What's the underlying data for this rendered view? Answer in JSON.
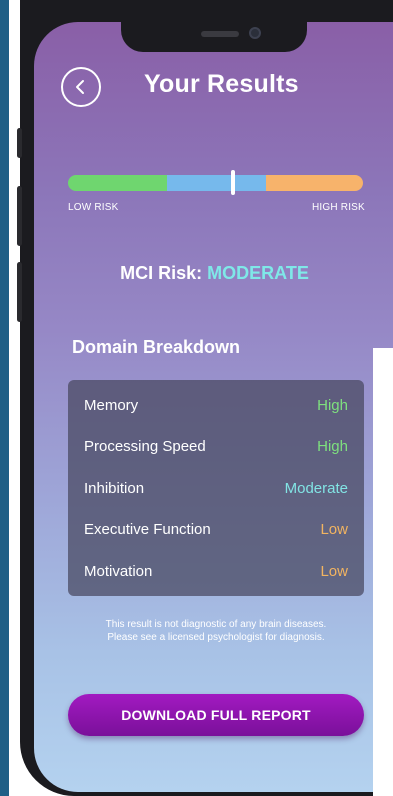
{
  "header": {
    "title": "Your Results",
    "back_icon": "chevron-left-icon"
  },
  "risk_scale": {
    "low_label": "LOW RISK",
    "high_label": "HIGH RISK",
    "colors": {
      "low": "#6fd66f",
      "moderate": "#76b9ec",
      "high": "#f7b36b"
    },
    "marker_position": 0.56
  },
  "mci": {
    "prefix": "MCI Risk:",
    "value": "MODERATE"
  },
  "domain_breakdown": {
    "title": "Domain Breakdown",
    "rows": [
      {
        "name": "Memory",
        "level": "High"
      },
      {
        "name": "Processing Speed",
        "level": "High"
      },
      {
        "name": "Inhibition",
        "level": "Moderate"
      },
      {
        "name": "Executive Function",
        "level": "Low"
      },
      {
        "name": "Motivation",
        "level": "Low"
      }
    ],
    "level_colors": {
      "High": "#7ee07e",
      "Moderate": "#82e4e4",
      "Low": "#f2b461"
    }
  },
  "disclaimer": {
    "line1": "This result is not diagnostic of any brain diseases.",
    "line2": "Please see a licensed psychologist for diagnosis."
  },
  "actions": {
    "download_label": "DOWNLOAD FULL REPORT"
  }
}
